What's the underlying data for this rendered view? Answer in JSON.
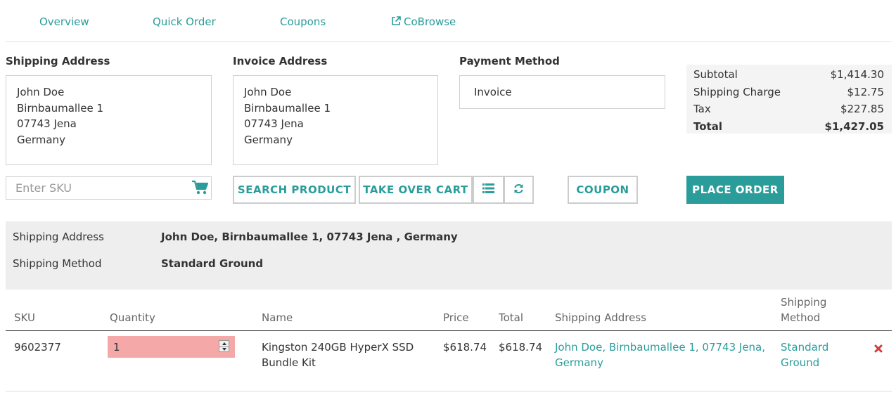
{
  "tabs": [
    {
      "label": "Overview"
    },
    {
      "label": "Quick Order"
    },
    {
      "label": "Coupons"
    },
    {
      "label": "CoBrowse",
      "icon": "external-link-icon"
    }
  ],
  "shipping_address": {
    "title": "Shipping Address",
    "lines": [
      "John Doe",
      "Birnbaumallee 1",
      "07743 Jena",
      "Germany"
    ]
  },
  "invoice_address": {
    "title": "Invoice Address",
    "lines": [
      "John Doe",
      "Birnbaumallee 1",
      "07743 Jena",
      "Germany"
    ]
  },
  "payment": {
    "title": "Payment Method",
    "value": "Invoice"
  },
  "totals": {
    "subtotal_label": "Subtotal",
    "subtotal": "$1,414.30",
    "shipping_label": "Shipping Charge",
    "shipping": "$12.75",
    "tax_label": "Tax",
    "tax": "$227.85",
    "total_label": "Total",
    "total": "$1,427.05"
  },
  "sku": {
    "placeholder": "Enter SKU",
    "icon": "cart-icon"
  },
  "buttons": {
    "search_product": "SEARCH PRODUCT",
    "take_over_cart": "TAKE OVER CART",
    "list_icon": "list-icon",
    "refresh_icon": "refresh-icon",
    "coupon": "COUPON",
    "place_order": "PLACE ORDER"
  },
  "shipping_info": {
    "address_label": "Shipping Address",
    "address_value": "John Doe, Birnbaumallee 1, 07743 Jena , Germany",
    "method_label": "Shipping Method",
    "method_value": "Standard Ground"
  },
  "table": {
    "headers": {
      "sku": "SKU",
      "quantity": "Quantity",
      "name": "Name",
      "price": "Price",
      "total": "Total",
      "shipping_address": "Shipping Address",
      "shipping_method_1": "Shipping",
      "shipping_method_2": "Method"
    },
    "rows": [
      {
        "sku": "9602377",
        "quantity": "1",
        "name_1": "Kingston 240GB HyperX SSD",
        "name_2": "Bundle Kit",
        "price": "$618.74",
        "total": "$618.74",
        "address_1": "John Doe, Birnbaumallee 1, 07743 Jena,",
        "address_2": "Germany",
        "method_1": "Standard",
        "method_2": "Ground"
      }
    ]
  },
  "colors": {
    "accent": "#2a9d9b",
    "error_field": "#f4a9a8",
    "remove": "#d9393b"
  }
}
